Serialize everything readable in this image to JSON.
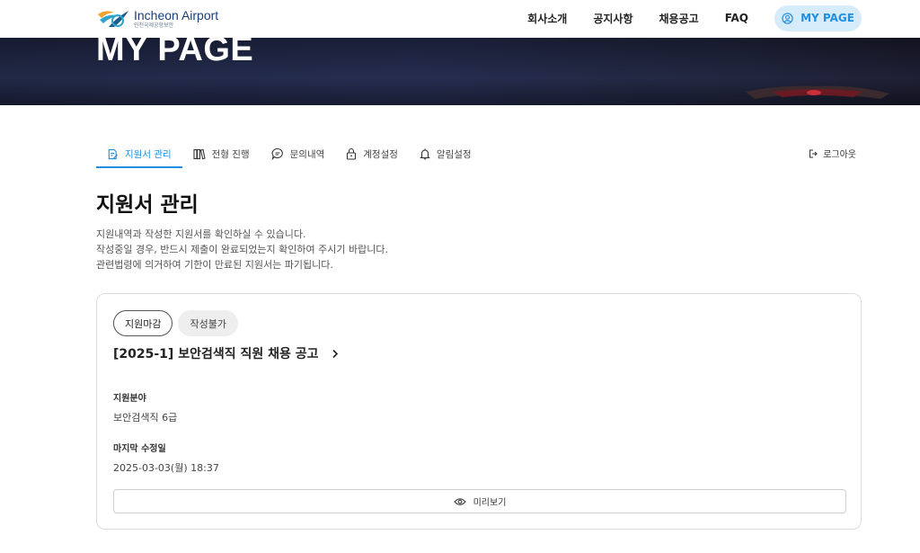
{
  "header": {
    "logo": {
      "name_en": "Incheon Airport",
      "name_ko": "인천국제공항보안"
    },
    "nav": [
      "회사소개",
      "공지사항",
      "채용공고",
      "FAQ"
    ],
    "mypage_label": "MY PAGE"
  },
  "banner": {
    "title": "MY PAGE"
  },
  "tabs": [
    {
      "label": "지원서 관리",
      "icon": "document-edit-icon",
      "active": true
    },
    {
      "label": "전형 진행",
      "icon": "books-icon",
      "active": false
    },
    {
      "label": "문의내역",
      "icon": "chat-bubble-icon",
      "active": false
    },
    {
      "label": "계정설정",
      "icon": "lock-icon",
      "active": false
    },
    {
      "label": "알림설정",
      "icon": "bell-icon",
      "active": false
    }
  ],
  "logout_label": "로그아웃",
  "page": {
    "title": "지원서 관리",
    "description": [
      "지원내역과 작성한 지원서를 확인하실 수 있습니다.",
      "작성중일 경우, 반드시 제출이 완료되었는지 확인하여 주시기 바랍니다.",
      "관련법령에 의거하여 기한이 만료된 지원서는 파기됩니다."
    ]
  },
  "application": {
    "badges": [
      "지원마감",
      "작성불가"
    ],
    "title": "[2025-1] 보안검색직 직원 채용 공고",
    "field_label": "지원분야",
    "field_value": "보안검색직 6급",
    "modified_label": "마지막 수정일",
    "modified_value": "2025-03-03(월) 18:37",
    "preview_label": "미리보기"
  },
  "colors": {
    "accent": "#1f8fe0",
    "accent_bg": "#d7ecfb",
    "banner": "#1d2440"
  }
}
